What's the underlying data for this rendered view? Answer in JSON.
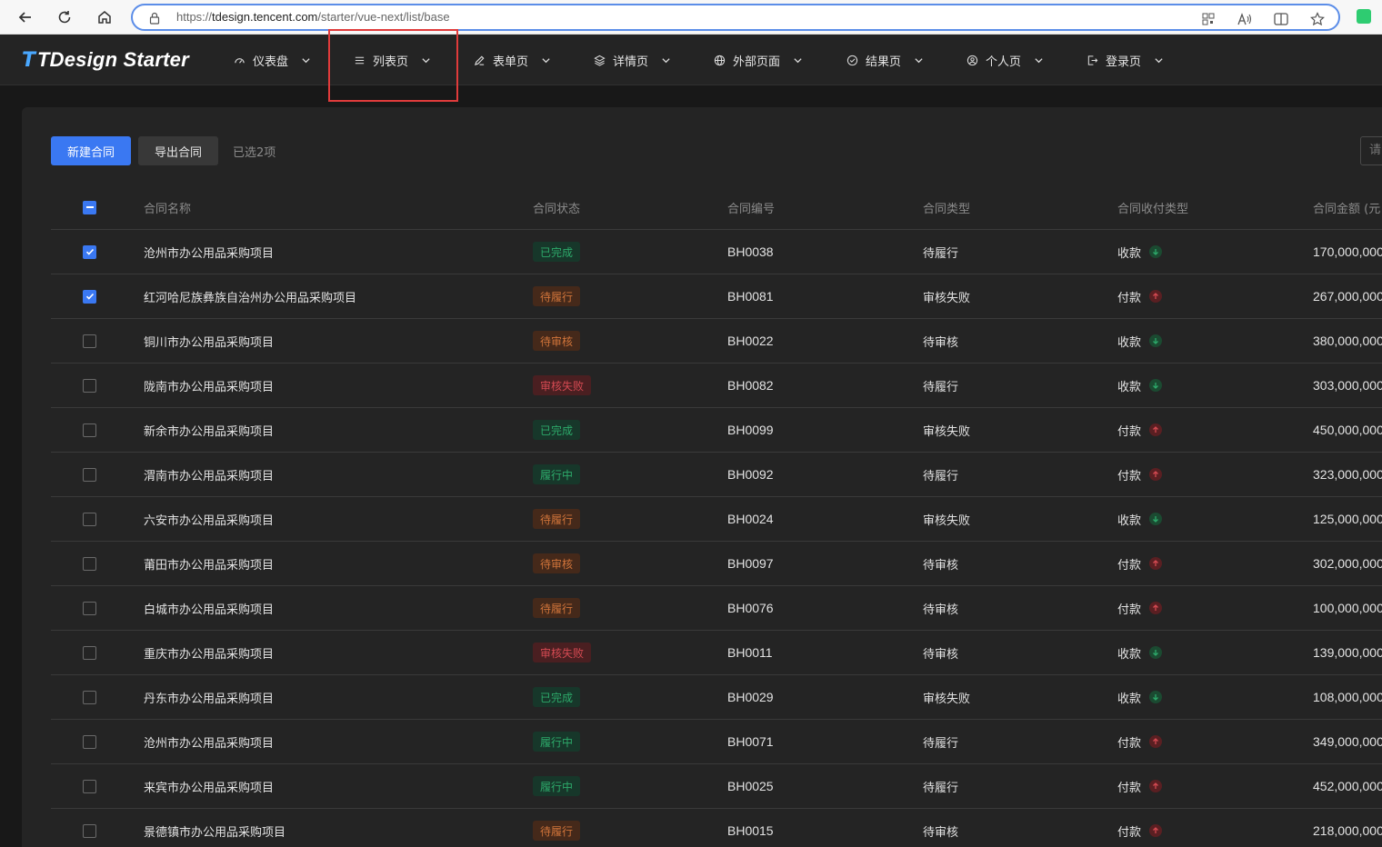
{
  "browser": {
    "url_prefix": "https://",
    "url_host": "tdesign.tencent.com",
    "url_path": "/starter/vue-next/list/base"
  },
  "header": {
    "logo_mark": "T",
    "logo_text": "TDesign Starter",
    "menu": [
      {
        "label": "仪表盘",
        "icon": "dashboard-icon"
      },
      {
        "label": "列表页",
        "icon": "list-icon"
      },
      {
        "label": "表单页",
        "icon": "edit-icon"
      },
      {
        "label": "详情页",
        "icon": "layers-icon"
      },
      {
        "label": "外部页面",
        "icon": "internet-icon"
      },
      {
        "label": "结果页",
        "icon": "check-circle-icon"
      },
      {
        "label": "个人页",
        "icon": "user-circle-icon"
      },
      {
        "label": "登录页",
        "icon": "logout-icon"
      }
    ]
  },
  "toolbar": {
    "new_label": "新建合同",
    "export_label": "导出合同",
    "selected_text": "已选2项",
    "search_placeholder": "请"
  },
  "table": {
    "columns": {
      "name": "合同名称",
      "status": "合同状态",
      "no": "合同编号",
      "type": "合同类型",
      "pay": "合同收付类型",
      "amount": "合同金额 (元"
    },
    "rows": [
      {
        "name": "沧州市办公用品采购项目",
        "status": "已完成",
        "status_color": "green",
        "no": "BH0038",
        "type": "待履行",
        "pay": "收款",
        "pay_dir": "down",
        "amount": "170,000,000",
        "checked": true
      },
      {
        "name": "红河哈尼族彝族自治州办公用品采购项目",
        "status": "待履行",
        "status_color": "orange",
        "no": "BH0081",
        "type": "审核失败",
        "pay": "付款",
        "pay_dir": "up",
        "amount": "267,000,000",
        "checked": true
      },
      {
        "name": "铜川市办公用品采购项目",
        "status": "待审核",
        "status_color": "orange",
        "no": "BH0022",
        "type": "待审核",
        "pay": "收款",
        "pay_dir": "down",
        "amount": "380,000,000",
        "checked": false
      },
      {
        "name": "陇南市办公用品采购项目",
        "status": "审核失败",
        "status_color": "red",
        "no": "BH0082",
        "type": "待履行",
        "pay": "收款",
        "pay_dir": "down",
        "amount": "303,000,000",
        "checked": false
      },
      {
        "name": "新余市办公用品采购项目",
        "status": "已完成",
        "status_color": "green",
        "no": "BH0099",
        "type": "审核失败",
        "pay": "付款",
        "pay_dir": "up",
        "amount": "450,000,000",
        "checked": false
      },
      {
        "name": "渭南市办公用品采购项目",
        "status": "履行中",
        "status_color": "green",
        "no": "BH0092",
        "type": "待履行",
        "pay": "付款",
        "pay_dir": "up",
        "amount": "323,000,000",
        "checked": false
      },
      {
        "name": "六安市办公用品采购项目",
        "status": "待履行",
        "status_color": "orange",
        "no": "BH0024",
        "type": "审核失败",
        "pay": "收款",
        "pay_dir": "down",
        "amount": "125,000,000",
        "checked": false
      },
      {
        "name": "莆田市办公用品采购项目",
        "status": "待审核",
        "status_color": "orange",
        "no": "BH0097",
        "type": "待审核",
        "pay": "付款",
        "pay_dir": "up",
        "amount": "302,000,000",
        "checked": false
      },
      {
        "name": "白城市办公用品采购项目",
        "status": "待履行",
        "status_color": "orange",
        "no": "BH0076",
        "type": "待审核",
        "pay": "付款",
        "pay_dir": "up",
        "amount": "100,000,000",
        "checked": false
      },
      {
        "name": "重庆市办公用品采购项目",
        "status": "审核失败",
        "status_color": "red",
        "no": "BH0011",
        "type": "待审核",
        "pay": "收款",
        "pay_dir": "down",
        "amount": "139,000,000",
        "checked": false
      },
      {
        "name": "丹东市办公用品采购项目",
        "status": "已完成",
        "status_color": "green",
        "no": "BH0029",
        "type": "审核失败",
        "pay": "收款",
        "pay_dir": "down",
        "amount": "108,000,000",
        "checked": false
      },
      {
        "name": "沧州市办公用品采购项目",
        "status": "履行中",
        "status_color": "green",
        "no": "BH0071",
        "type": "待履行",
        "pay": "付款",
        "pay_dir": "up",
        "amount": "349,000,000",
        "checked": false
      },
      {
        "name": "来宾市办公用品采购项目",
        "status": "履行中",
        "status_color": "green",
        "no": "BH0025",
        "type": "待履行",
        "pay": "付款",
        "pay_dir": "up",
        "amount": "452,000,000",
        "checked": false
      },
      {
        "name": "景德镇市办公用品采购项目",
        "status": "待履行",
        "status_color": "orange",
        "no": "BH0015",
        "type": "待审核",
        "pay": "付款",
        "pay_dir": "up",
        "amount": "218,000,000",
        "checked": false
      }
    ]
  },
  "colors": {
    "primary": "#3a78f2",
    "success": "#2da96a",
    "warning": "#d0743a",
    "error": "#d44a52",
    "highlight": "#e03b3b"
  }
}
